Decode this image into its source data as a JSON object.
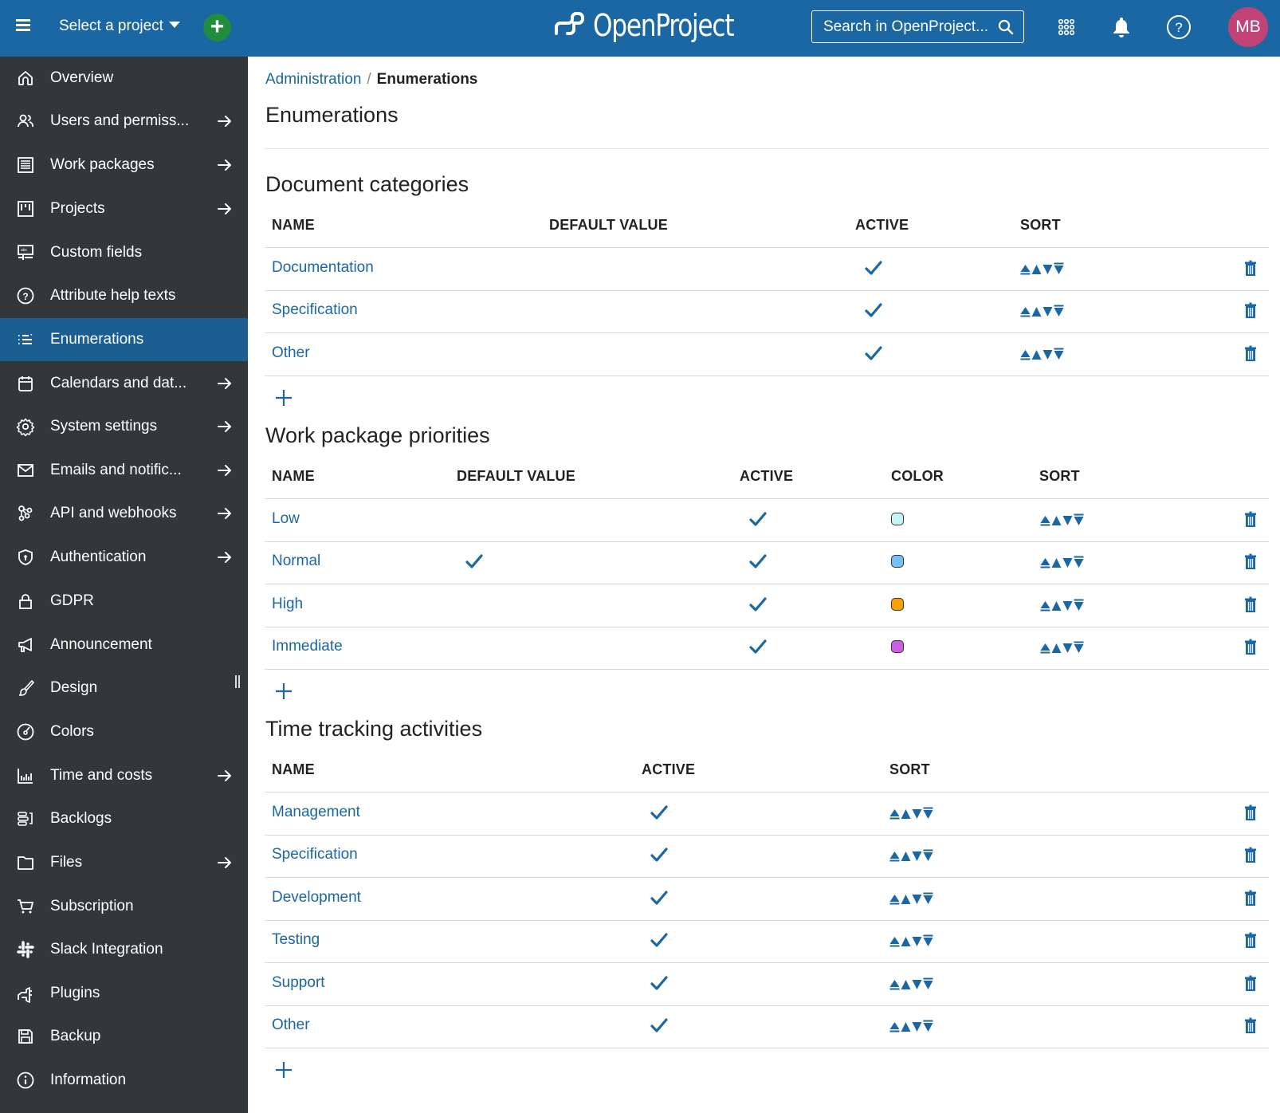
{
  "header": {
    "project_select_label": "Select a project",
    "logo_text": "OpenProject",
    "search_placeholder": "Search in OpenProject...",
    "avatar_initials": "MB",
    "avatar_color": "#c34275",
    "brand_color": "#1a67a3",
    "add_button_color": "#1f8c3e"
  },
  "sidebar": {
    "active_color": "#1b5f92",
    "items": [
      {
        "label": "Overview",
        "icon": "home-icon",
        "has_arrow": false,
        "active": false
      },
      {
        "label": "Users and permiss...",
        "icon": "users-icon",
        "has_arrow": true,
        "active": false
      },
      {
        "label": "Work packages",
        "icon": "work-packages-icon",
        "has_arrow": true,
        "active": false
      },
      {
        "label": "Projects",
        "icon": "projects-board-icon",
        "has_arrow": true,
        "active": false
      },
      {
        "label": "Custom fields",
        "icon": "custom-fields-icon",
        "has_arrow": false,
        "active": false
      },
      {
        "label": "Attribute help texts",
        "icon": "help-circle-icon",
        "has_arrow": false,
        "active": false
      },
      {
        "label": "Enumerations",
        "icon": "enumerations-icon",
        "has_arrow": false,
        "active": true
      },
      {
        "label": "Calendars and dat...",
        "icon": "calendar-icon",
        "has_arrow": true,
        "active": false
      },
      {
        "label": "System settings",
        "icon": "gear-icon",
        "has_arrow": true,
        "active": false
      },
      {
        "label": "Emails and notific...",
        "icon": "mail-icon",
        "has_arrow": true,
        "active": false
      },
      {
        "label": "API and webhooks",
        "icon": "webhooks-icon",
        "has_arrow": true,
        "active": false
      },
      {
        "label": "Authentication",
        "icon": "shield-icon",
        "has_arrow": true,
        "active": false
      },
      {
        "label": "GDPR",
        "icon": "lock-icon",
        "has_arrow": false,
        "active": false
      },
      {
        "label": "Announcement",
        "icon": "megaphone-icon",
        "has_arrow": false,
        "active": false
      },
      {
        "label": "Design",
        "icon": "paintbrush-icon",
        "has_arrow": false,
        "active": false
      },
      {
        "label": "Colors",
        "icon": "colors-dial-icon",
        "has_arrow": false,
        "active": false
      },
      {
        "label": "Time and costs",
        "icon": "bar-chart-icon",
        "has_arrow": true,
        "active": false
      },
      {
        "label": "Backlogs",
        "icon": "backlogs-icon",
        "has_arrow": false,
        "active": false
      },
      {
        "label": "Files",
        "icon": "folder-icon",
        "has_arrow": true,
        "active": false
      },
      {
        "label": "Subscription",
        "icon": "cart-icon",
        "has_arrow": false,
        "active": false
      },
      {
        "label": "Slack Integration",
        "icon": "slack-icon",
        "has_arrow": false,
        "active": false
      },
      {
        "label": "Plugins",
        "icon": "plugin-icon",
        "has_arrow": false,
        "active": false
      },
      {
        "label": "Backup",
        "icon": "save-disk-icon",
        "has_arrow": false,
        "active": false
      },
      {
        "label": "Information",
        "icon": "info-icon",
        "has_arrow": false,
        "active": false
      }
    ]
  },
  "breadcrumb": {
    "parent": "Administration",
    "separator": "/",
    "current": "Enumerations"
  },
  "page_title": "Enumerations",
  "sections": [
    {
      "title": "Document categories",
      "columns": [
        "NAME",
        "DEFAULT VALUE",
        "ACTIVE",
        "SORT"
      ],
      "rows": [
        {
          "name": "Documentation",
          "default": false,
          "active": true
        },
        {
          "name": "Specification",
          "default": false,
          "active": true
        },
        {
          "name": "Other",
          "default": false,
          "active": true
        }
      ]
    },
    {
      "title": "Work package priorities",
      "columns": [
        "NAME",
        "DEFAULT VALUE",
        "ACTIVE",
        "COLOR",
        "SORT"
      ],
      "rows": [
        {
          "name": "Low",
          "default": false,
          "active": true,
          "color": "#c5f5f8"
        },
        {
          "name": "Normal",
          "default": true,
          "active": true,
          "color": "#74c0fc"
        },
        {
          "name": "High",
          "default": false,
          "active": true,
          "color": "#f8a000"
        },
        {
          "name": "Immediate",
          "default": false,
          "active": true,
          "color": "#cc5de8"
        }
      ]
    },
    {
      "title": "Time tracking activities",
      "columns": [
        "NAME",
        "ACTIVE",
        "SORT"
      ],
      "rows": [
        {
          "name": "Management",
          "active": true
        },
        {
          "name": "Specification",
          "active": true
        },
        {
          "name": "Development",
          "active": true
        },
        {
          "name": "Testing",
          "active": true
        },
        {
          "name": "Support",
          "active": true
        },
        {
          "name": "Other",
          "active": true
        }
      ]
    }
  ]
}
